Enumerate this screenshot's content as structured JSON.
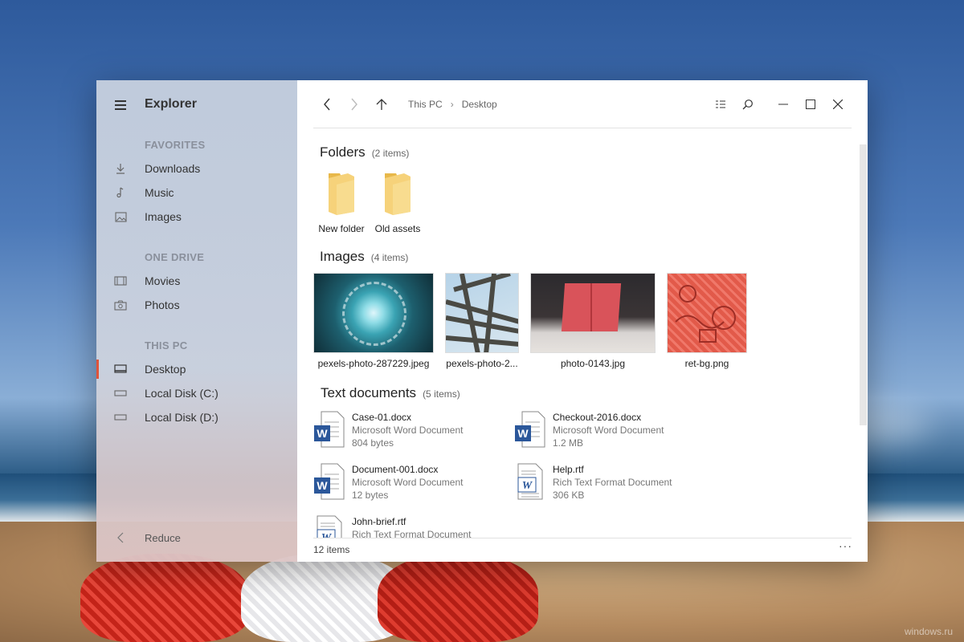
{
  "app": {
    "title": "Explorer"
  },
  "sidebar": {
    "sections": [
      {
        "title": "FAVORITES",
        "items": [
          {
            "label": "Downloads",
            "icon": "download-icon"
          },
          {
            "label": "Music",
            "icon": "music-note-icon"
          },
          {
            "label": "Images",
            "icon": "image-icon"
          }
        ]
      },
      {
        "title": "ONE DRIVE",
        "items": [
          {
            "label": "Movies",
            "icon": "film-icon"
          },
          {
            "label": "Photos",
            "icon": "camera-icon"
          }
        ]
      },
      {
        "title": "THIS PC",
        "items": [
          {
            "label": "Desktop",
            "icon": "desktop-icon",
            "active": true
          },
          {
            "label": "Local Disk (C:)",
            "icon": "drive-icon"
          },
          {
            "label": "Local Disk (D:)",
            "icon": "drive-icon"
          }
        ]
      }
    ],
    "reduce_label": "Reduce"
  },
  "breadcrumb": [
    "This PC",
    "Desktop"
  ],
  "groups": {
    "folders": {
      "title": "Folders",
      "count": "(2 items)",
      "items": [
        "New folder",
        "Old assets"
      ]
    },
    "images": {
      "title": "Images",
      "count": "(4 items)",
      "items": [
        "pexels-photo-287229.jpeg",
        "pexels-photo-2...",
        "photo-0143.jpg",
        "ret-bg.png"
      ]
    },
    "documents": {
      "title": "Text documents",
      "count": "(5 items)",
      "items": [
        {
          "name": "Case-01.docx",
          "type": "Microsoft Word Document",
          "size": "804 bytes",
          "icon": "word-doc-icon"
        },
        {
          "name": "Checkout-2016.docx",
          "type": "Microsoft Word Document",
          "size": "1.2 MB",
          "icon": "word-doc-icon"
        },
        {
          "name": "Document-001.docx",
          "type": "Microsoft Word Document",
          "size": "12 bytes",
          "icon": "word-doc-icon"
        },
        {
          "name": "Help.rtf",
          "type": "Rich Text Format Document",
          "size": "306 KB",
          "icon": "rtf-doc-icon"
        },
        {
          "name": "John-brief.rtf",
          "type": "Rich Text Format Document",
          "size": "",
          "icon": "rtf-doc-icon"
        }
      ]
    }
  },
  "status": {
    "count": "12 items",
    "more": "···"
  },
  "colors": {
    "accent": "#e0533a",
    "folder": "#f4c95d",
    "word_blue": "#2b579a"
  },
  "watermark": "windows.ru"
}
